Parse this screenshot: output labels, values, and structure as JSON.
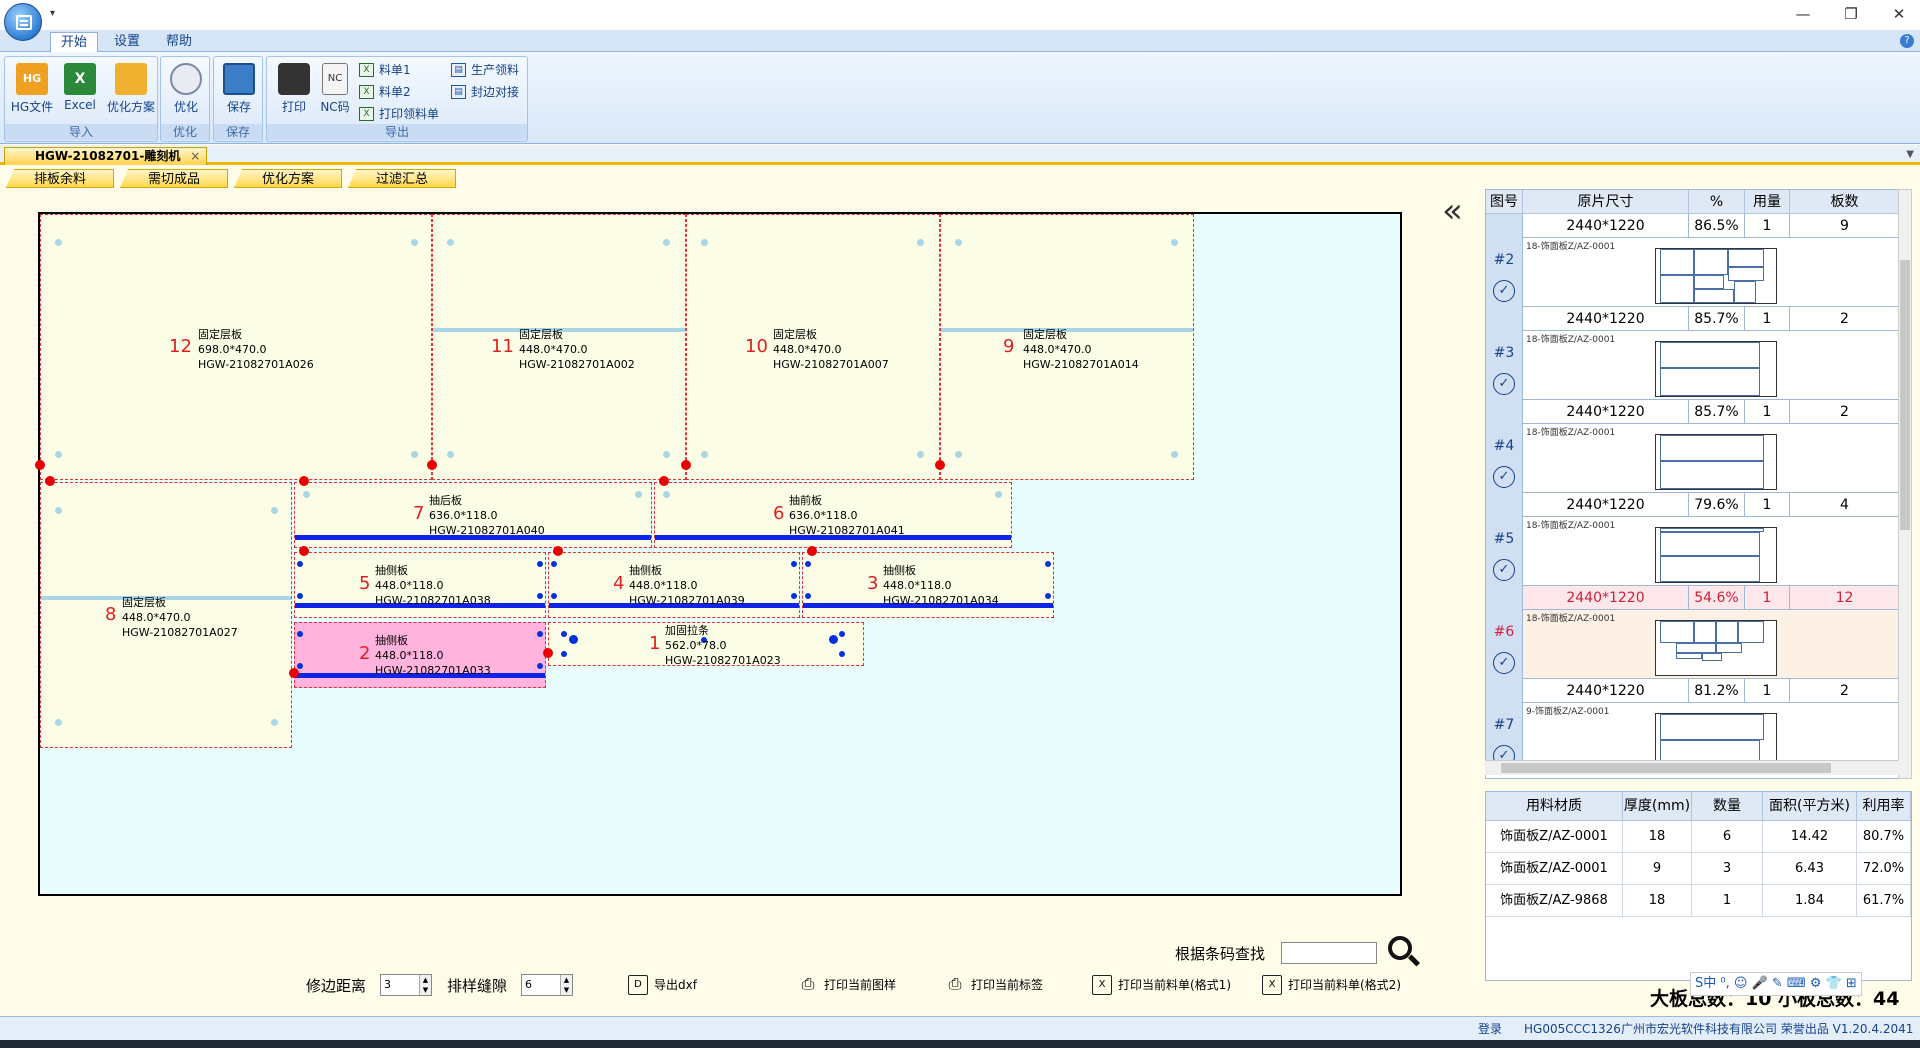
{
  "window": {
    "qat_label": "▾",
    "min": "—",
    "max": "❐",
    "close": "✕"
  },
  "ribbon": {
    "tabs": [
      "开始",
      "设置",
      "帮助"
    ],
    "groups": {
      "import": {
        "label": "导入",
        "hg": "HG文件",
        "excel": "Excel",
        "plan": "优化方案"
      },
      "optimize": {
        "label": "优化",
        "btn": "优化"
      },
      "save": {
        "label": "保存",
        "btn": "保存"
      },
      "export": {
        "label": "导出",
        "print": "打印",
        "nc": "NC码",
        "list1": "料单1",
        "list2": "料单2",
        "printpick": "打印领料单",
        "prodpick": "生产领料",
        "edgejoin": "封边对接"
      }
    }
  },
  "doc_tab": {
    "title": "HGW-21082701-雕刻机",
    "close": "×"
  },
  "sub_tabs": [
    "排板余料",
    "需切成品",
    "优化方案",
    "过滤汇总"
  ],
  "pieces": [
    {
      "num": "12",
      "name": "固定层板",
      "size": "698.0*470.0",
      "code": "HGW-21082701A026"
    },
    {
      "num": "11",
      "name": "固定层板",
      "size": "448.0*470.0",
      "code": "HGW-21082701A002"
    },
    {
      "num": "10",
      "name": "固定层板",
      "size": "448.0*470.0",
      "code": "HGW-21082701A007"
    },
    {
      "num": "9",
      "name": "固定层板",
      "size": "448.0*470.0",
      "code": "HGW-21082701A014"
    },
    {
      "num": "8",
      "name": "固定层板",
      "size": "448.0*470.0",
      "code": "HGW-21082701A027"
    },
    {
      "num": "7",
      "name": "抽后板",
      "size": "636.0*118.0",
      "code": "HGW-21082701A040"
    },
    {
      "num": "6",
      "name": "抽前板",
      "size": "636.0*118.0",
      "code": "HGW-21082701A041"
    },
    {
      "num": "5",
      "name": "抽侧板",
      "size": "448.0*118.0",
      "code": "HGW-21082701A038"
    },
    {
      "num": "4",
      "name": "抽侧板",
      "size": "448.0*118.0",
      "code": "HGW-21082701A039"
    },
    {
      "num": "3",
      "name": "抽侧板",
      "size": "448.0*118.0",
      "code": "HGW-21082701A034"
    },
    {
      "num": "2",
      "name": "抽侧板",
      "size": "448.0*118.0",
      "code": "HGW-21082701A033"
    },
    {
      "num": "1",
      "name": "加固拉条",
      "size": "562.0*78.0",
      "code": "HGW-21082701A023"
    }
  ],
  "plan_table": {
    "headers": [
      "图号",
      "原片尺寸",
      "%",
      "用量",
      "板数"
    ],
    "rows": [
      {
        "id": "#2",
        "size": "2440*1220",
        "pct": "86.5%",
        "qty": "1",
        "boards": "9",
        "mat": "18-饰面板Z/AZ-0001"
      },
      {
        "id": "#3",
        "size": "2440*1220",
        "pct": "85.7%",
        "qty": "1",
        "boards": "2",
        "mat": "18-饰面板Z/AZ-0001"
      },
      {
        "id": "#4",
        "size": "2440*1220",
        "pct": "85.7%",
        "qty": "1",
        "boards": "2",
        "mat": "18-饰面板Z/AZ-0001"
      },
      {
        "id": "#5",
        "size": "2440*1220",
        "pct": "79.6%",
        "qty": "1",
        "boards": "4",
        "mat": "18-饰面板Z/AZ-0001"
      },
      {
        "id": "#6",
        "size": "2440*1220",
        "pct": "54.6%",
        "qty": "1",
        "boards": "12",
        "mat": "18-饰面板Z/AZ-0001"
      },
      {
        "id": "#7",
        "size": "2440*1220",
        "pct": "81.2%",
        "qty": "1",
        "boards": "2",
        "mat": "9-饰面板Z/AZ-0001"
      }
    ]
  },
  "material_table": {
    "headers": [
      "用料材质",
      "厚度(mm)",
      "数量",
      "面积(平方米)",
      "利用率"
    ],
    "rows": [
      [
        "饰面板Z/AZ-0001",
        "18",
        "6",
        "14.42",
        "80.7%"
      ],
      [
        "饰面板Z/AZ-0001",
        "9",
        "3",
        "6.43",
        "72.0%"
      ],
      [
        "饰面板Z/AZ-9868",
        "18",
        "1",
        "1.84",
        "61.7%"
      ]
    ]
  },
  "controls": {
    "edge_label": "修边距离",
    "edge_value": "3",
    "gap_label": "排样缝隙",
    "gap_value": "6",
    "export_dxf": "导出dxf",
    "print_pattern": "打印当前图样",
    "print_label": "打印当前标签",
    "print_list1": "打印当前料单(格式1)",
    "print_list2": "打印当前料单(格式2)",
    "find_label": "根据条码查找",
    "totals": "大板总数：10  小板总数：44"
  },
  "ime": "S中 ⁰, ☺ 🎤 ✎ ⌨ ⚙ 👕 ⊞",
  "status": {
    "login": "登录",
    "machine": "HG005CCC1326",
    "company": "广州市宏光软件科技有限公司 荣誉出品 V1.20.4.2041"
  }
}
